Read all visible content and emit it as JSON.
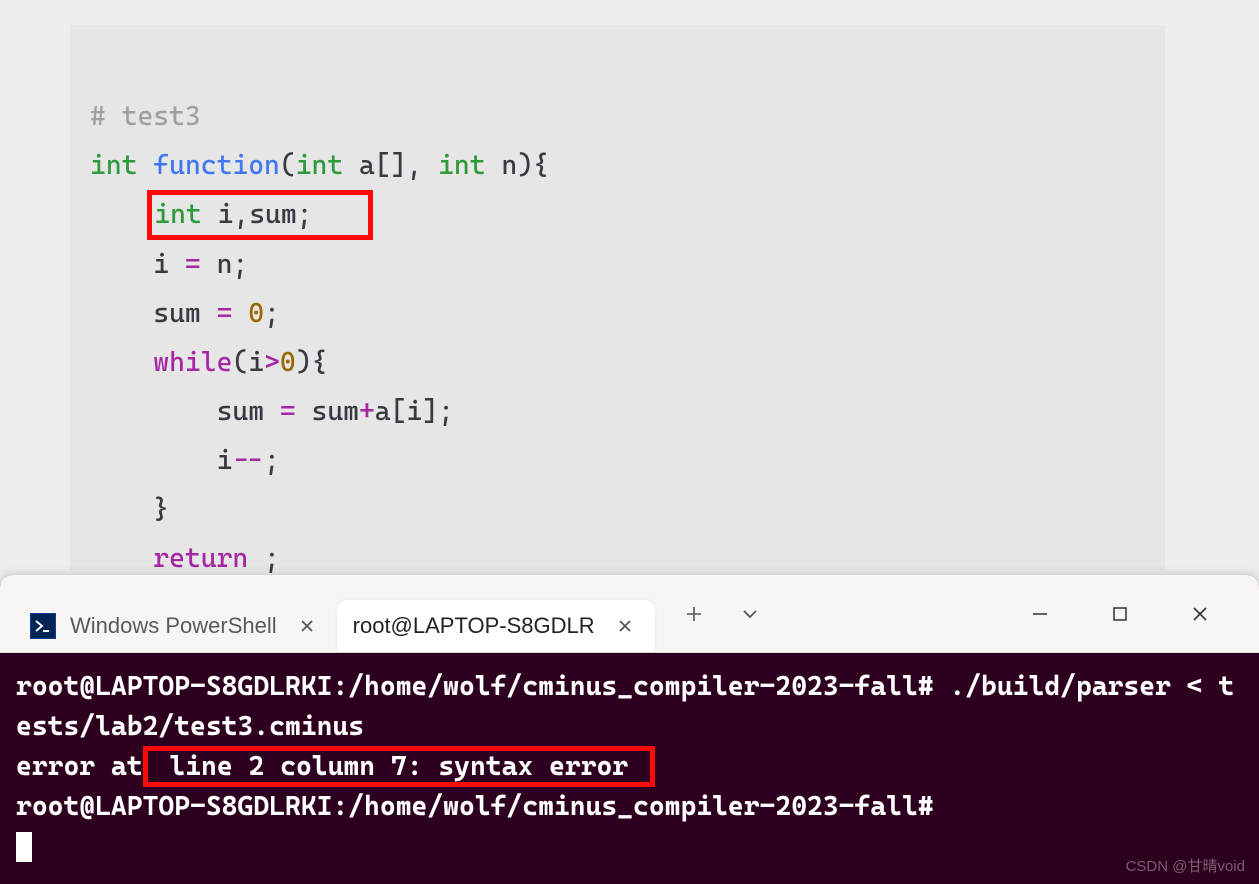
{
  "code": {
    "comment": "# test3",
    "kw_int": "int",
    "fn_name": "function",
    "paren_open": "(",
    "param_a": "a[]",
    "comma_sp": ", ",
    "param_n": "n",
    "paren_close_brace": "){",
    "decl_hl_trail": " i,sum;",
    "line_i_eq": "i ",
    "eq": "=",
    "sp_n_semi": " n;",
    "line_sum": "sum ",
    "zero": "0",
    "semi": ";",
    "while_kw": "while",
    "while_open": "(i",
    "gt": ">",
    "while_close": "){",
    "sum_assign": "sum ",
    "rhs": " sum",
    "plus": "+",
    "rhs2": "a[i];",
    "i_var": "i",
    "decdec": "--",
    "brace_close": "}",
    "return_kw": "return",
    "return_tail": " ;"
  },
  "tabs": {
    "powershell_label": "Windows PowerShell",
    "active_label": "root@LAPTOP-S8GDLR"
  },
  "terminal": {
    "line1": "root@LAPTOP-S8GDLRKI:/home/wolf/cminus_compiler-2023-fall# ./build/parser < tests/lab2/test3.cminus",
    "err_pre": "error at",
    "err_hl": " line 2 column 7: syntax error ",
    "line3": "root@LAPTOP-S8GDLRKI:/home/wolf/cminus_compiler-2023-fall# "
  },
  "watermark": "CSDN @甘晴void"
}
